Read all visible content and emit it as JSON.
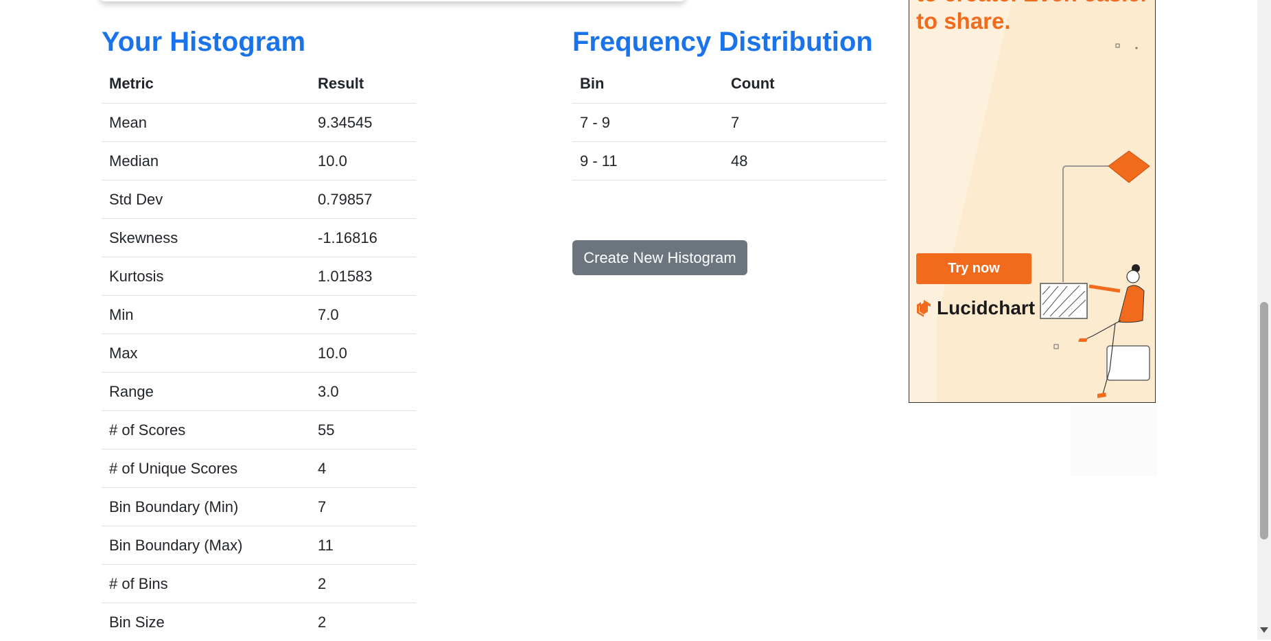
{
  "histogram": {
    "heading": "Your Histogram",
    "columns": [
      "Metric",
      "Result"
    ],
    "rows": [
      [
        "Mean",
        "9.34545"
      ],
      [
        "Median",
        "10.0"
      ],
      [
        "Std Dev",
        "0.79857"
      ],
      [
        "Skewness",
        "-1.16816"
      ],
      [
        "Kurtosis",
        "1.01583"
      ],
      [
        "Min",
        "7.0"
      ],
      [
        "Max",
        "10.0"
      ],
      [
        "Range",
        "3.0"
      ],
      [
        "# of Scores",
        "55"
      ],
      [
        "# of Unique Scores",
        "4"
      ],
      [
        "Bin Boundary (Min)",
        "7"
      ],
      [
        "Bin Boundary (Max)",
        "11"
      ],
      [
        "# of Bins",
        "2"
      ],
      [
        "Bin Size",
        "2"
      ]
    ]
  },
  "frequency": {
    "heading": "Frequency Distribution",
    "columns": [
      "Bin",
      "Count"
    ],
    "rows": [
      [
        "7 - 9",
        "7"
      ],
      [
        "9 - 11",
        "48"
      ]
    ]
  },
  "actions": {
    "create_new_label": "Create New Histogram"
  },
  "ad": {
    "headline": "to create. Even easier to share.",
    "cta_label": "Try now",
    "brand": "Lucidchart",
    "accent": "#f26b1d",
    "background": "#fdf0dc"
  },
  "colors": {
    "heading": "#1a73e8",
    "button": "#6c757d"
  }
}
